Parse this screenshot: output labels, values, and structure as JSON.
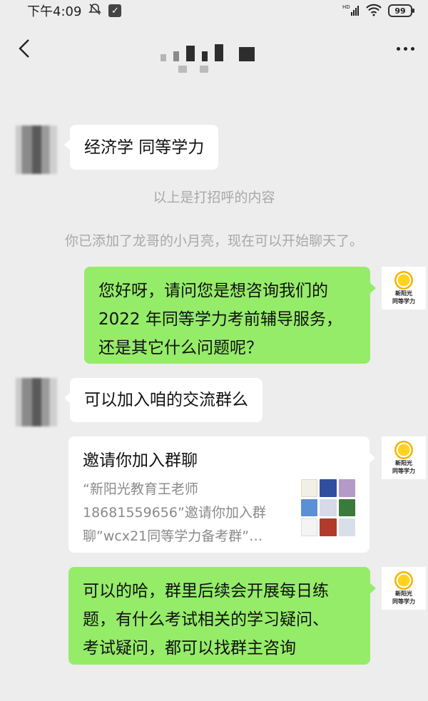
{
  "status_bar": {
    "time": "下午4:09",
    "network": "HD",
    "battery": "99"
  },
  "header": {
    "title_hidden": true
  },
  "messages": [
    {
      "id": "m1",
      "side": "in",
      "text": "经济学 同等学力"
    },
    {
      "id": "sys1",
      "type": "system",
      "text": "以上是打招呼的内容"
    },
    {
      "id": "sys2",
      "type": "system",
      "text": "你已添加了龙哥的小月亮，现在可以开始聊天了。"
    },
    {
      "id": "m2",
      "side": "out",
      "lines": [
        "您好呀，请问您是想咨询我们的",
        "2022 年同等学力考前辅导服务，",
        "还是其它什么问题呢？"
      ]
    },
    {
      "id": "m3",
      "side": "in",
      "text": "可以加入咱的交流群么"
    },
    {
      "id": "m4",
      "side": "out",
      "type": "invite_card",
      "title": "邀请你加入群聊",
      "desc_lines": [
        "“新阳光教育王老师",
        "18681559656”邀请你加入群",
        "聊”wcx21同等学力备考群”…"
      ]
    },
    {
      "id": "m5",
      "side": "out",
      "lines": [
        "可以的哈，群里后续会开展每日练",
        "题，有什么考试相关的学习疑问、",
        "考试疑问，都可以找群主咨询"
      ]
    }
  ],
  "self_avatar": {
    "brand_line1": "新阳光",
    "brand_line2": "同等学力"
  },
  "colors": {
    "background": "#ededed",
    "outgoing_bubble": "#95ec69",
    "incoming_bubble": "#ffffff",
    "system_text": "#a8a8a8"
  },
  "icons": [
    "back-icon",
    "more-icon",
    "mute-icon",
    "check-icon",
    "wifi-icon",
    "signal-icon"
  ]
}
